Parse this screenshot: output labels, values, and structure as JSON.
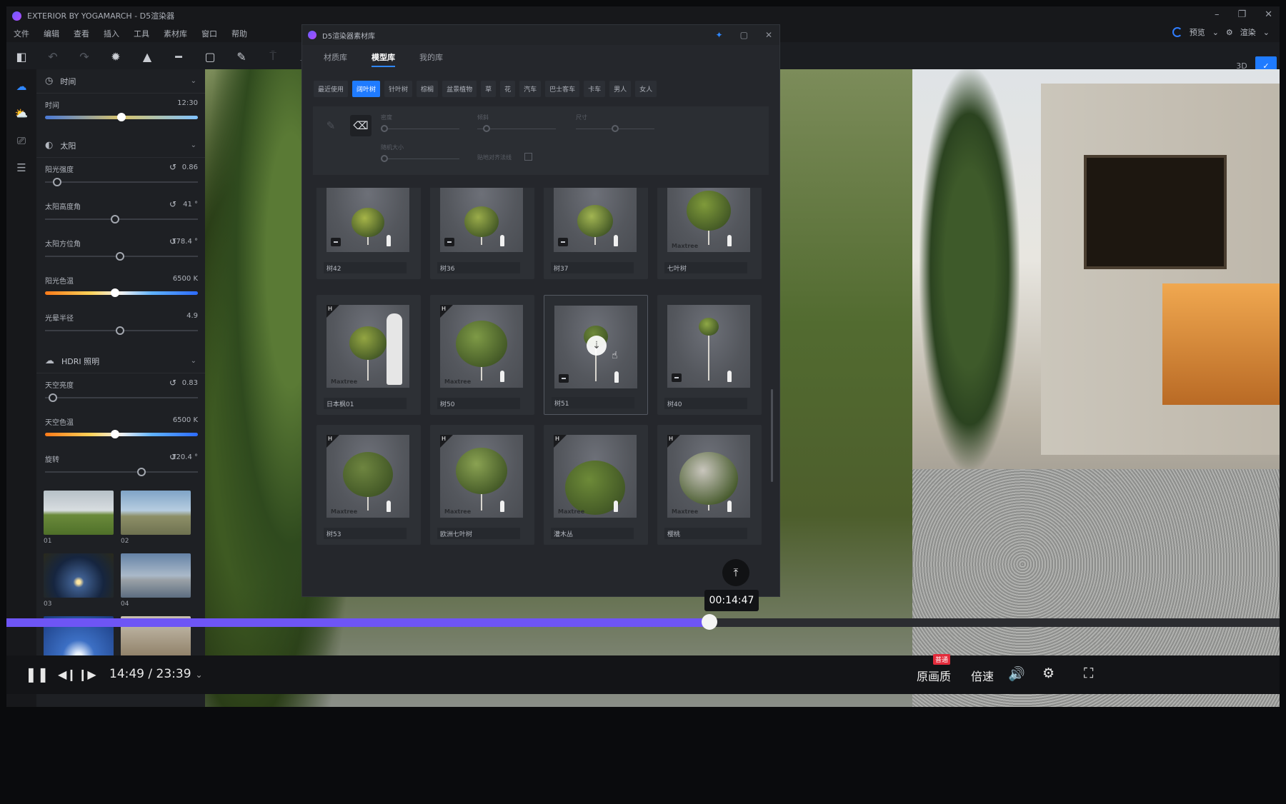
{
  "window": {
    "title": "EXTERIOR BY YOGAMARCH - D5渲染器",
    "controls": [
      "–",
      "❐",
      "✕"
    ]
  },
  "menubar": [
    "文件",
    "编辑",
    "查看",
    "插入",
    "工具",
    "素材库",
    "窗口",
    "帮助"
  ],
  "top_right": {
    "render_label": "预览",
    "settings_label": "渲染"
  },
  "view_toggle": {
    "label_3d": "3D",
    "label_active": "✓"
  },
  "left_panel": {
    "time_section": {
      "title": "时间",
      "time_label": "时间",
      "time_value": "12:30",
      "time_fraction": 0.5
    },
    "sun_section": {
      "title": "太阳",
      "props": [
        {
          "label": "阳光强度",
          "value": "0.86",
          "fraction": 0.08
        },
        {
          "label": "太阳高度角",
          "value": "41 °",
          "fraction": 0.46
        },
        {
          "label": "太阳方位角",
          "value": "178.4 °",
          "fraction": 0.49
        },
        {
          "label": "阳光色温",
          "value": "6500 K",
          "fraction": 0.46
        },
        {
          "label": "光晕半径",
          "value": "4.9",
          "fraction": 0.49
        }
      ]
    },
    "hdri_section": {
      "title": "HDRI 照明",
      "props": [
        {
          "label": "天空亮度",
          "value": "0.83",
          "fraction": 0.05
        },
        {
          "label": "天空色温",
          "value": "6500 K",
          "fraction": 0.46
        },
        {
          "label": "旋转",
          "value": "220.4 °",
          "fraction": 0.63
        }
      ],
      "thumbs": [
        "01",
        "02",
        "03",
        "04",
        "",
        ""
      ]
    }
  },
  "dialog": {
    "title": "D5渲染器素材库",
    "tabs": [
      "材质库",
      "模型库",
      "我的库"
    ],
    "active_tab": 1,
    "categories": [
      "最近使用",
      "阔叶树",
      "针叶树",
      "棕榈",
      "盆景植物",
      "草",
      "花",
      "汽车",
      "巴士客车",
      "卡车",
      "男人",
      "女人"
    ],
    "active_category": 1,
    "tools": {
      "density_label": "密度",
      "angle_label": "倾斜",
      "size_label": "尺寸",
      "random_size_label": "随机大小",
      "align_label": "贴地对齐法线"
    },
    "cards": [
      {
        "name": "树42",
        "type": "m"
      },
      {
        "name": "树36",
        "type": "m"
      },
      {
        "name": "树37",
        "type": "m"
      },
      {
        "name": "七叶树",
        "type": "brand"
      },
      {
        "name": "日本枫01",
        "type": "h"
      },
      {
        "name": "树50",
        "type": "h"
      },
      {
        "name": "树51",
        "type": "m_dl"
      },
      {
        "name": "树40",
        "type": "m"
      },
      {
        "name": "树53",
        "type": "h"
      },
      {
        "name": "欧洲七叶树",
        "type": "h"
      },
      {
        "name": "灌木丛",
        "type": "h"
      },
      {
        "name": "樱桃",
        "type": "h"
      }
    ],
    "brand": "Maxtree",
    "badge_h": "H"
  },
  "player": {
    "tooltip_time": "00:14:47",
    "current": "14:49",
    "total": "23:39",
    "time_display": "14:49 / 23:39",
    "progress_fraction": 0.552,
    "quality_label": "原画质",
    "quality_badge": "普通",
    "speed_label": "倍速"
  },
  "colors": {
    "accent": "#1f7bff",
    "progress": "#6e55f5"
  }
}
